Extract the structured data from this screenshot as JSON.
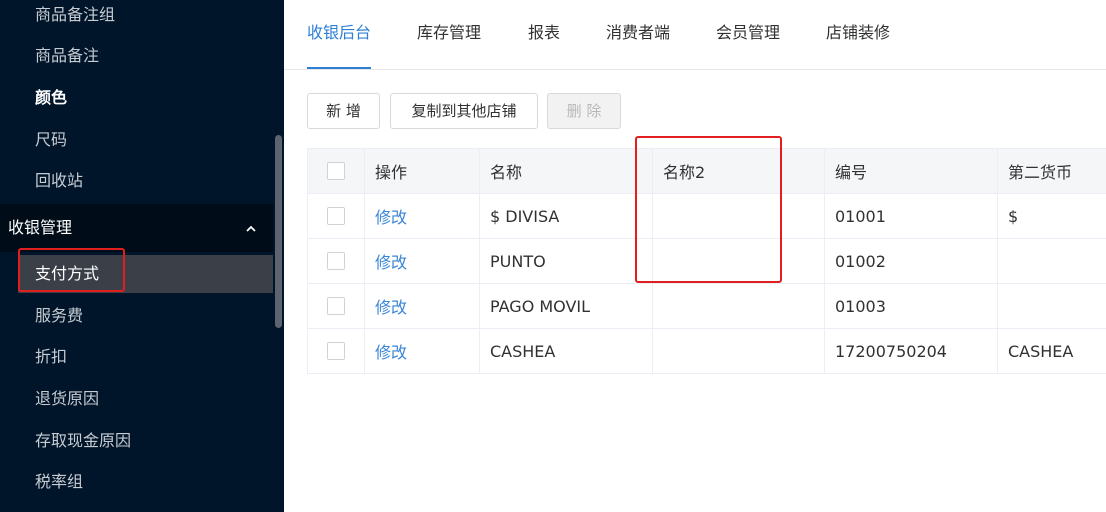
{
  "sidebar": {
    "items_top": [
      {
        "label": "商品备注组"
      },
      {
        "label": "商品备注"
      },
      {
        "label": "颜色"
      },
      {
        "label": "尺码"
      },
      {
        "label": "回收站"
      }
    ],
    "group_label": "收银管理",
    "group_items": [
      {
        "label": "支付方式"
      },
      {
        "label": "服务费"
      },
      {
        "label": "折扣"
      },
      {
        "label": "退货原因"
      },
      {
        "label": "存取现金原因"
      },
      {
        "label": "税率组"
      }
    ]
  },
  "tabs": [
    {
      "label": "收银后台"
    },
    {
      "label": "库存管理"
    },
    {
      "label": "报表"
    },
    {
      "label": "消费者端"
    },
    {
      "label": "会员管理"
    },
    {
      "label": "店铺装修"
    }
  ],
  "toolbar": {
    "add_label": "新 增",
    "copy_label": "复制到其他店铺",
    "delete_label": "删 除"
  },
  "table": {
    "headers": [
      "操作",
      "名称",
      "名称2",
      "编号",
      "第二货币"
    ],
    "rows": [
      {
        "action": "修改",
        "name": "$ DIVISA",
        "name2": "",
        "code": "01001",
        "currency": "$"
      },
      {
        "action": "修改",
        "name": "PUNTO",
        "name2": "",
        "code": "01002",
        "currency": ""
      },
      {
        "action": "修改",
        "name": "PAGO MOVIL",
        "name2": "",
        "code": "01003",
        "currency": ""
      },
      {
        "action": "修改",
        "name": "CASHEA",
        "name2": "",
        "code": "17200750204",
        "currency": "CASHEA"
      }
    ]
  },
  "colors": {
    "sidebar_bg": "#001529",
    "accent": "#2d7fd6",
    "highlight": "#e21f1f"
  }
}
